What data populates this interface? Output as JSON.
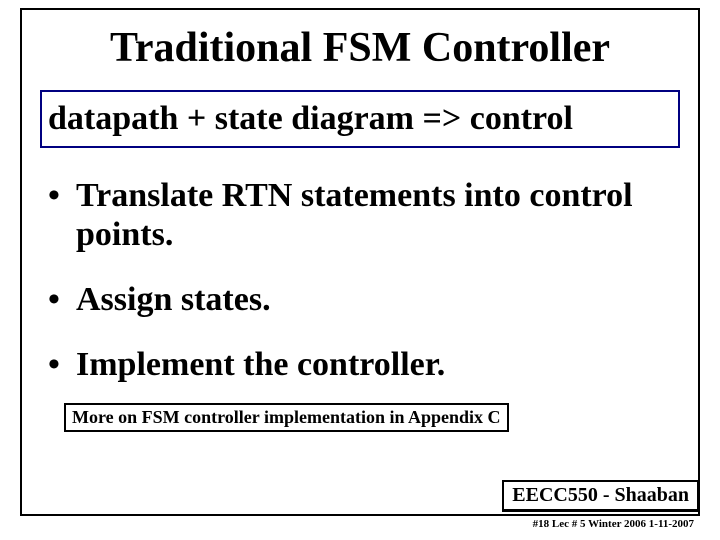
{
  "title": "Traditional FSM Controller",
  "subtitle": "datapath +  state diagram  =>  control",
  "bullets": [
    "Translate RTN statements into control points.",
    "Assign states.",
    "Implement the controller."
  ],
  "note": "More on FSM controller implementation in Appendix C",
  "footer": {
    "course": "EECC550 - Shaaban",
    "meta": "#18   Lec # 5  Winter 2006  1-11-2007"
  }
}
